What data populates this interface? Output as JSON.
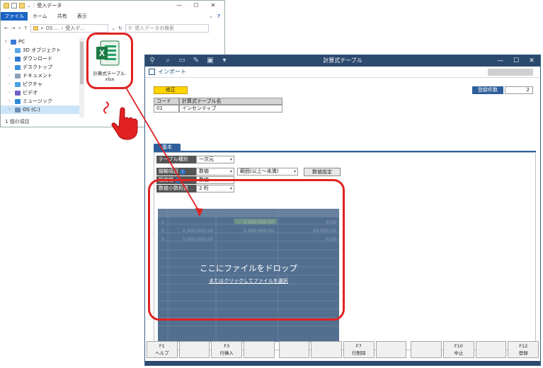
{
  "explorer": {
    "title": "受入データ",
    "ribbon_tabs": [
      "ファイル",
      "ホーム",
      "共有",
      "表示"
    ],
    "address_parts": [
      "«",
      "OS ...",
      "›",
      "受入デ..."
    ],
    "search_placeholder": "受入データの検索",
    "tree": [
      {
        "label": "PC",
        "icon": "pc-icon",
        "color": "#3b7ad6"
      },
      {
        "label": "3D オブジェクト",
        "icon": "3d-objects-icon",
        "color": "#58a8e8"
      },
      {
        "label": "ダウンロード",
        "icon": "download-icon",
        "color": "#2f7ad0"
      },
      {
        "label": "デスクトップ",
        "icon": "desktop-icon",
        "color": "#3b8ee0"
      },
      {
        "label": "ドキュメント",
        "icon": "documents-icon",
        "color": "#8da0b8"
      },
      {
        "label": "ピクチャ",
        "icon": "pictures-icon",
        "color": "#4aa0e0"
      },
      {
        "label": "ビデオ",
        "icon": "videos-icon",
        "color": "#7060c8"
      },
      {
        "label": "ミュージック",
        "icon": "music-icon",
        "color": "#2a8ad8"
      },
      {
        "label": "OS (C:)",
        "icon": "drive-icon",
        "color": "#6a8fb8"
      }
    ],
    "status": "1 個の項目",
    "file": {
      "name_line1": "計算式テーブル.",
      "name_line2": "xlsx",
      "icon": "excel-icon",
      "color": "#1e7a45"
    }
  },
  "app": {
    "title": "計算式テーブル",
    "subtitle": "インポート",
    "mode_badge": "修正",
    "count_label": "登録件数",
    "count_value": "2",
    "code_header": "コード",
    "name_header": "計算式テーブル名",
    "code_value": "01",
    "name_value": "インセンティブ",
    "tab_label": "基本",
    "form": {
      "table_type_label": "テーブル種別",
      "table_type_value": "一次元",
      "axis_label": "縦軸項目",
      "axis_value": "数値",
      "range_value": "範囲(以上～未満)",
      "setting_label": "設定値",
      "setting_value": "数値",
      "decimal_label": "数値小数桁数",
      "decimal_value": "2 桁",
      "numeric_setting_button": "数値設定"
    },
    "drop_text": "ここにファイルをドロップ",
    "drop_link": "またはクリックしてファイルを選択",
    "drop_bg_rows": [
      {
        "no": "1",
        "from": "",
        "to": "3,000,000.00",
        "val": "0.00"
      },
      {
        "no": "2",
        "from": "2,000,000.00",
        "to": "5,000,000.00",
        "val": "20,000.00"
      },
      {
        "no": "3",
        "from": "5,000,000.00",
        "to": "",
        "val": "0.00"
      }
    ],
    "fkeys": [
      {
        "key": "F1",
        "label": "ヘルプ"
      },
      {
        "key": "",
        "label": ""
      },
      {
        "key": "F3",
        "label": "行挿入"
      },
      {
        "key": "",
        "label": ""
      },
      {
        "key": "",
        "label": ""
      },
      {
        "key": "",
        "label": ""
      },
      {
        "key": "F7",
        "label": "行削除"
      },
      {
        "key": "",
        "label": ""
      },
      {
        "key": "",
        "label": ""
      },
      {
        "key": "F10",
        "label": "中止"
      },
      {
        "key": "",
        "label": ""
      },
      {
        "key": "F12",
        "label": "登録"
      }
    ],
    "accent_color": "#2c4a6e",
    "highlight_color": "#e02222"
  }
}
